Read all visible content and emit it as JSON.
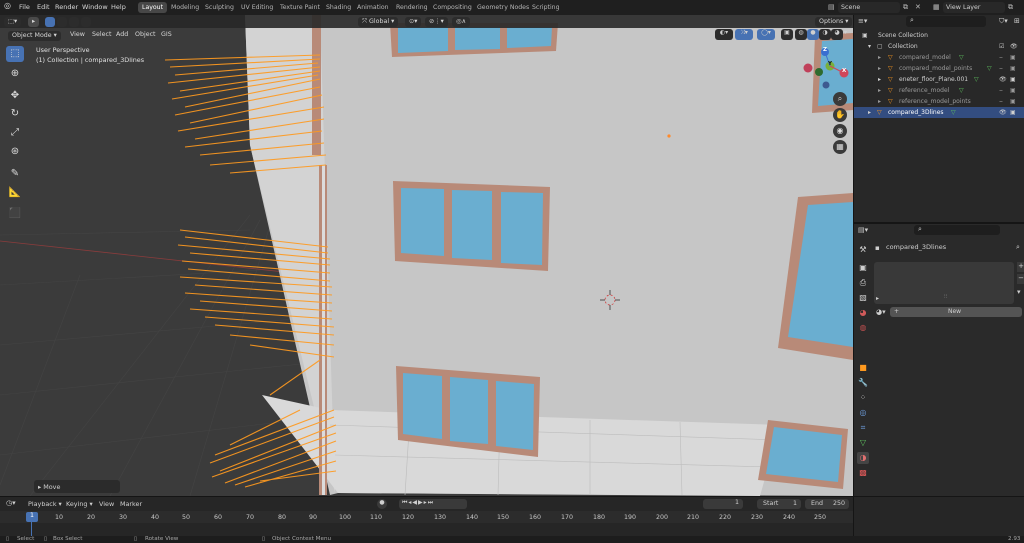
{
  "topbar": {
    "menus": [
      "File",
      "Edit",
      "Render",
      "Window",
      "Help"
    ],
    "workspaces": [
      "Layout",
      "Modeling",
      "Sculpting",
      "UV Editing",
      "Texture Paint",
      "Shading",
      "Animation",
      "Rendering",
      "Compositing",
      "Geometry Nodes",
      "Scripting"
    ],
    "active_workspace": "Layout",
    "scene": "Scene",
    "view_layer": "View Layer"
  },
  "viewport": {
    "mode": "Object Mode",
    "menus": [
      "View",
      "Select",
      "Add",
      "Object",
      "GIS"
    ],
    "orientation": "Global",
    "options": "Options",
    "perspective_label": "User Perspective",
    "collection_label": "(1) Collection | compared_3Dlines",
    "operator_panel": "Move",
    "gizmo_axes": [
      "X",
      "Y",
      "Z"
    ]
  },
  "outliner": {
    "root": "Scene Collection",
    "collection": "Collection",
    "items": [
      {
        "label": "compared_model",
        "selected": false,
        "dim": true
      },
      {
        "label": "compared_model_points",
        "selected": false,
        "dim": true
      },
      {
        "label": "eneter_floor_Plane.001",
        "selected": false,
        "dim": false
      },
      {
        "label": "reference_model",
        "selected": false,
        "dim": true
      },
      {
        "label": "reference_model_points",
        "selected": false,
        "dim": true
      },
      {
        "label": "compared_3Dlines",
        "selected": true,
        "dim": false
      }
    ]
  },
  "properties": {
    "object_name": "compared_3Dlines",
    "new_button": "New"
  },
  "timeline": {
    "menus": [
      "Playback",
      "Keying",
      "View",
      "Marker"
    ],
    "current_frame": "1",
    "start_label": "Start",
    "start": "1",
    "end_label": "End",
    "end": "250",
    "ruler": [
      "1",
      "10",
      "20",
      "30",
      "40",
      "50",
      "60",
      "70",
      "80",
      "90",
      "100",
      "110",
      "120",
      "130",
      "140",
      "150",
      "160",
      "170",
      "180",
      "190",
      "200",
      "210",
      "220",
      "230",
      "240",
      "250"
    ]
  },
  "statusbar": {
    "items": [
      "Select",
      "Box Select",
      "Rotate View",
      "Object Context Menu"
    ],
    "version": "2.93"
  },
  "colors": {
    "accent": "#4772b3",
    "lines": "#ff9a1f",
    "window_glass": "#6aaed0",
    "window_frame": "#b88a78",
    "wall": "#c8c8c8"
  }
}
